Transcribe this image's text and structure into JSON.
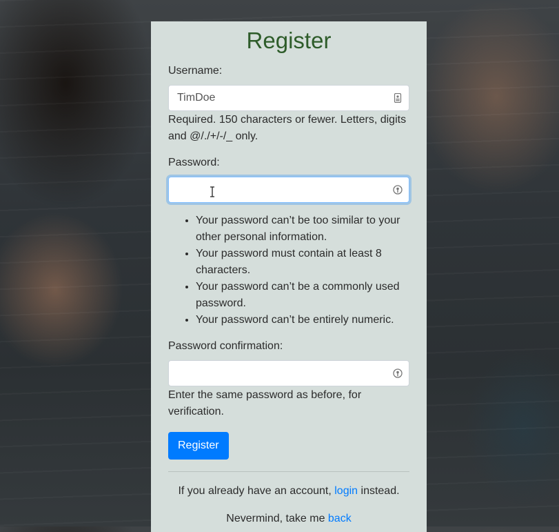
{
  "form": {
    "title": "Register",
    "username": {
      "label": "Username:",
      "value": "TimDoe",
      "help": "Required. 150 characters or fewer. Letters, digits and @/./+/-/_ only."
    },
    "password": {
      "label": "Password:",
      "value": "",
      "rules": [
        "Your password can’t be too similar to your other personal information.",
        "Your password must contain at least 8 characters.",
        "Your password can’t be a commonly used password.",
        "Your password can’t be entirely numeric."
      ]
    },
    "password_confirmation": {
      "label": "Password confirmation:",
      "value": "",
      "help": "Enter the same password as before, for verification."
    },
    "submit_label": "Register"
  },
  "footer": {
    "login_prefix": "If you already have an account, ",
    "login_link": "login",
    "login_suffix": " instead.",
    "back_prefix": "Nevermind, take me ",
    "back_link": "back"
  },
  "colors": {
    "panel": "#d5dedb",
    "title": "#2e5c2a",
    "accent": "#007bff"
  },
  "icons": {
    "username_field": "contact-card-icon",
    "password_field": "key-icon",
    "confirm_field": "key-icon",
    "cursor": "text-cursor-icon"
  }
}
